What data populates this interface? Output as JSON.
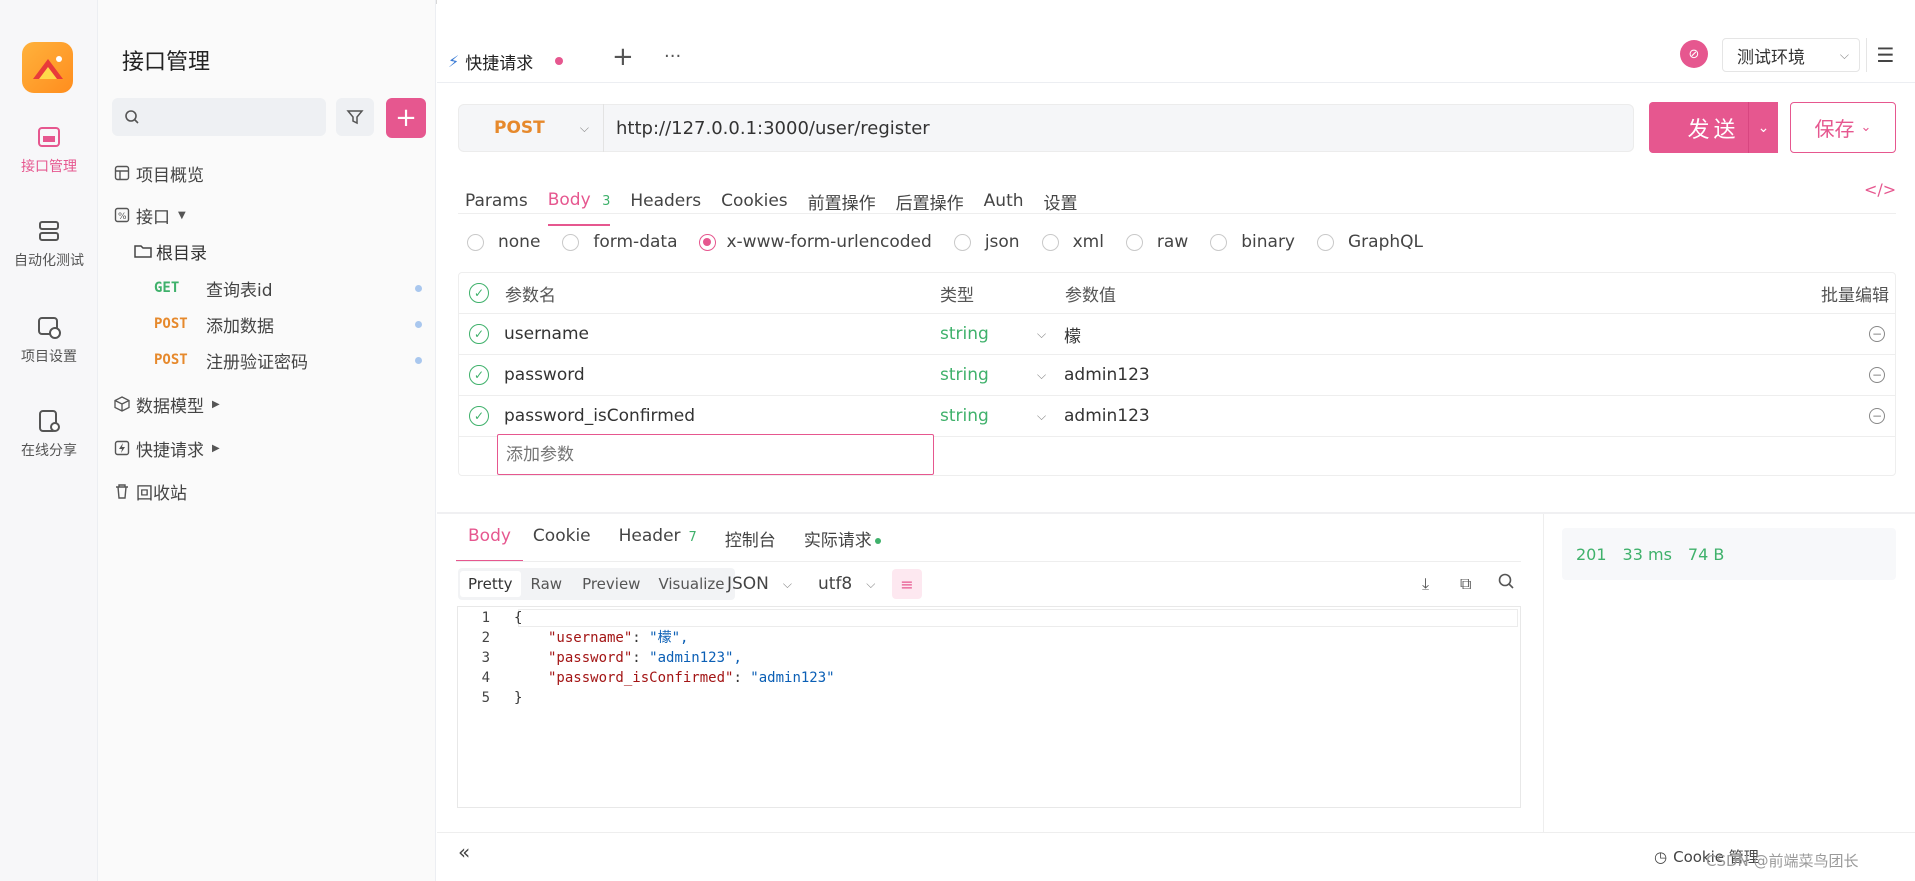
{
  "colors": {
    "accent": "#e6578f",
    "get": "#3fb16b",
    "post": "#e6892c",
    "status_ok": "#3fb16b"
  },
  "rail": {
    "items": [
      {
        "label": "接口管理",
        "icon": "api-icon",
        "active": true
      },
      {
        "label": "自动化测试",
        "icon": "test-icon"
      },
      {
        "label": "项目设置",
        "icon": "settings-icon"
      },
      {
        "label": "在线分享",
        "icon": "share-icon"
      }
    ]
  },
  "nav": {
    "title": "接口管理",
    "search_placeholder": "",
    "overview": "项目概览",
    "interface": "接口",
    "root": "根目录",
    "apis": [
      {
        "method": "GET",
        "name": "查询表id"
      },
      {
        "method": "POST",
        "name": "添加数据"
      },
      {
        "method": "POST",
        "name": "注册验证密码"
      }
    ],
    "data_model": "数据模型",
    "quick_request": "快捷请求",
    "recycle": "回收站"
  },
  "tabs": {
    "active": "快捷请求",
    "add": "+",
    "more": "···"
  },
  "env": {
    "label": "测试环境"
  },
  "request": {
    "method": "POST",
    "url": "http://127.0.0.1:3000/user/register",
    "send": "发送",
    "save": "保存"
  },
  "req_tabs": [
    {
      "label": "Params"
    },
    {
      "label": "Body",
      "badge": "3",
      "active": true
    },
    {
      "label": "Headers"
    },
    {
      "label": "Cookies"
    },
    {
      "label": "前置操作"
    },
    {
      "label": "后置操作"
    },
    {
      "label": "Auth"
    },
    {
      "label": "设置"
    }
  ],
  "body_types": [
    "none",
    "form-data",
    "x-www-form-urlencoded",
    "json",
    "xml",
    "raw",
    "binary",
    "GraphQL"
  ],
  "body_type_selected": "x-www-form-urlencoded",
  "params_table": {
    "headers": {
      "name": "参数名",
      "type": "类型",
      "value": "参数值",
      "bulk": "批量编辑"
    },
    "rows": [
      {
        "name": "username",
        "type": "string",
        "value": "檬"
      },
      {
        "name": "password",
        "type": "string",
        "value": "admin123"
      },
      {
        "name": "password_isConfirmed",
        "type": "string",
        "value": "admin123"
      }
    ],
    "add_placeholder": "添加参数"
  },
  "resp_tabs": [
    {
      "label": "Body",
      "active": true
    },
    {
      "label": "Cookie"
    },
    {
      "label": "Header",
      "badge": "7"
    },
    {
      "label": "控制台"
    },
    {
      "label": "实际请求"
    }
  ],
  "view_modes": [
    "Pretty",
    "Raw",
    "Preview",
    "Visualize"
  ],
  "format": "JSON",
  "encoding": "utf8",
  "response": {
    "status": "201",
    "time": "33 ms",
    "size": "74 B",
    "lines": [
      {
        "n": "1",
        "text": "{"
      },
      {
        "n": "2",
        "key": "\"username\"",
        "val": "\"檬\","
      },
      {
        "n": "3",
        "key": "\"password\"",
        "val": "\"admin123\","
      },
      {
        "n": "4",
        "key": "\"password_isConfirmed\"",
        "val": "\"admin123\""
      },
      {
        "n": "5",
        "text": "}"
      }
    ]
  },
  "footer": {
    "cookie_mgr": "Cookie 管理",
    "watermark": "CSDN @前端菜鸟团长"
  }
}
